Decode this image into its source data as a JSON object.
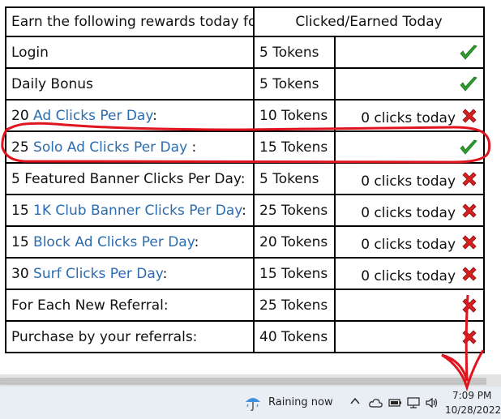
{
  "table": {
    "headers": {
      "activity": "Earn the following rewards today for each activity",
      "status": "Clicked/Earned Today"
    },
    "rows": [
      {
        "prefix": "Login",
        "link": "",
        "suffix": "",
        "amount": "5 Tokens",
        "clicks": "",
        "status": "check"
      },
      {
        "prefix": "Daily Bonus",
        "link": "",
        "suffix": "",
        "amount": "5 Tokens",
        "clicks": "",
        "status": "check"
      },
      {
        "prefix": "20 ",
        "link": "Ad Clicks Per Day",
        "suffix": ":",
        "amount": "10 Tokens",
        "clicks": "0 clicks today",
        "status": "cross"
      },
      {
        "prefix": "25 ",
        "link": "Solo Ad Clicks Per Day",
        "suffix": " :",
        "amount": "15 Tokens",
        "clicks": "",
        "status": "check"
      },
      {
        "prefix": "5 Featured Banner Clicks Per Day:",
        "link": "",
        "suffix": "",
        "amount": "5 Tokens",
        "clicks": "0 clicks today",
        "status": "cross"
      },
      {
        "prefix": "15 ",
        "link": "1K Club Banner Clicks Per Day",
        "suffix": ":",
        "amount": "25 Tokens",
        "clicks": "0 clicks today",
        "status": "cross"
      },
      {
        "prefix": "15 ",
        "link": "Block Ad Clicks Per Day",
        "suffix": ":",
        "amount": "20 Tokens",
        "clicks": "0 clicks today",
        "status": "cross"
      },
      {
        "prefix": "30 ",
        "link": "Surf Clicks Per Day",
        "suffix": ":",
        "amount": "15 Tokens",
        "clicks": "0 clicks today",
        "status": "cross"
      },
      {
        "prefix": "For Each New Referral:",
        "link": "",
        "suffix": "",
        "amount": "25 Tokens",
        "clicks": "",
        "status": "cross"
      },
      {
        "prefix": "Purchase by your referrals:",
        "link": "",
        "suffix": "",
        "amount": "40 Tokens",
        "clicks": "",
        "status": "cross"
      }
    ]
  },
  "taskbar": {
    "weather": "Raining now",
    "weather_icon": "rain-umbrella-icon",
    "time": "7:09 PM",
    "date": "10/28/2022"
  },
  "colors": {
    "link": "#2b6cb0",
    "check": "#2e9e2e",
    "cross": "#d42020",
    "annotation": "#e0141e"
  }
}
